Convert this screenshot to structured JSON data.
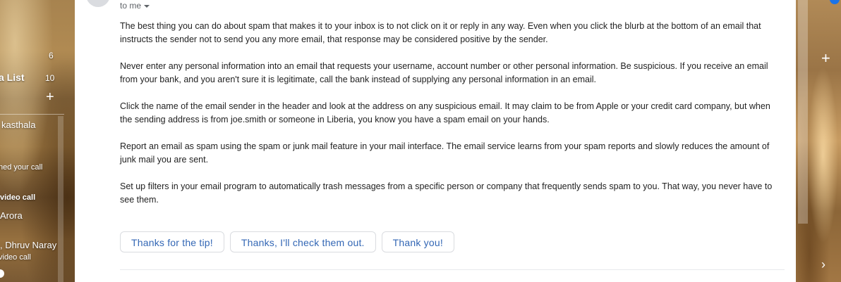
{
  "sidebar": {
    "items": [
      {
        "label": "",
        "count": "6"
      },
      {
        "label": "a List",
        "count": "10"
      }
    ],
    "chats": [
      {
        "name": "kasthala",
        "status": ""
      },
      {
        "name": "",
        "status": "ned your call"
      },
      {
        "name": "",
        "status": "video call"
      },
      {
        "name": "Arora",
        "status": ""
      },
      {
        "name": ", Dhruv Naray",
        "status": "video call"
      }
    ]
  },
  "email": {
    "recipient": "to me",
    "paragraphs": [
      "The best thing you can do about spam that makes it to your inbox is to not click on it or reply in any way. Even when you click the blurb at the bottom of an email that instructs the sender not to send you any more email, that response may be considered positive by the sender.",
      "Never enter any personal information into an email that requests your username, account number or other personal information. Be suspicious. If you receive an email from your bank, and you aren't sure it is legitimate, call the bank instead of supplying any personal information in an email.",
      "Click the name of the email sender in the header and look at the address on any suspicious email. It may claim to be from Apple or your credit card company, but when the sending address is from joe.smith or someone in Liberia, you know you have a spam email on your hands.",
      "Report an email as spam using the spam or junk mail feature in your mail interface. The email service learns from your spam reports and slowly reduces the amount of junk mail you are sent.",
      "Set up filters in your email program to automatically trash messages from a specific person or company that frequently sends spam to you. That way, you never have to see them."
    ],
    "smart_replies": [
      "Thanks for the tip!",
      "Thanks, I'll check them out.",
      "Thank you!"
    ]
  },
  "icons": {
    "add_label": "plus-icon",
    "add_addon": "plus-icon",
    "expand_panel": "chevron-right-icon",
    "recipient_menu": "caret-down-icon"
  },
  "colors": {
    "reply_text": "#3367b5",
    "reply_border": "#dadce0",
    "body_text": "#222222"
  }
}
